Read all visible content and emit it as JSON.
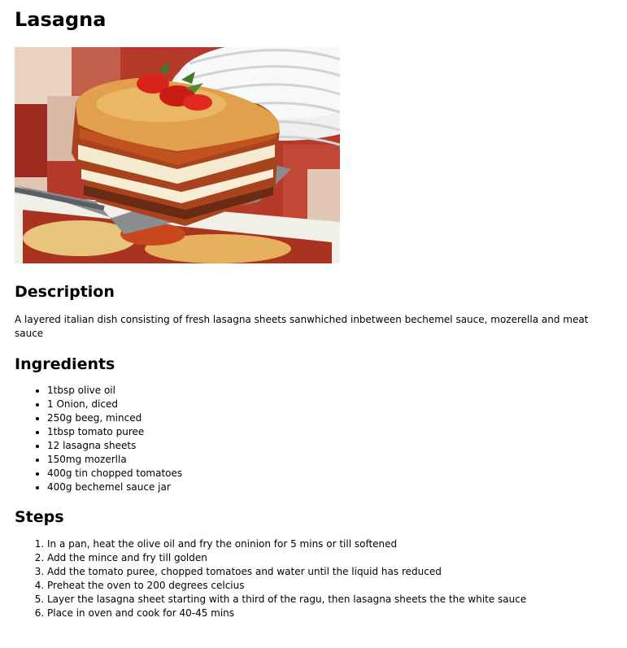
{
  "recipe": {
    "title": "Lasagna",
    "image_alt": "lasagna-photo",
    "description_heading": "Description",
    "description": "A layered italian dish consisting of fresh lasagna sheets sanwhiched inbetween bechemel sauce, mozerella and meat sauce",
    "ingredients_heading": "Ingredients",
    "ingredients": [
      "1tbsp olive oil",
      "1 Onion, diced",
      "250g beeg, minced",
      "1tbsp tomato puree",
      "12 lasagna sheets",
      "150mg mozerlla",
      "400g tin chopped tomatoes",
      "400g bechemel sauce jar"
    ],
    "steps_heading": "Steps",
    "steps": [
      "In a pan, heat the olive oil and fry the oninion for 5 mins or till softened",
      "Add the mince and fry till golden",
      "Add the tomato puree, chopped tomatoes and water until the liquid has reduced",
      "Preheat the oven to 200 degrees celcius",
      "Layer the lasagna sheet starting with a third of the ragu, then lasagna sheets the the white sauce",
      "Place in oven and cook for 40-45 mins"
    ]
  }
}
